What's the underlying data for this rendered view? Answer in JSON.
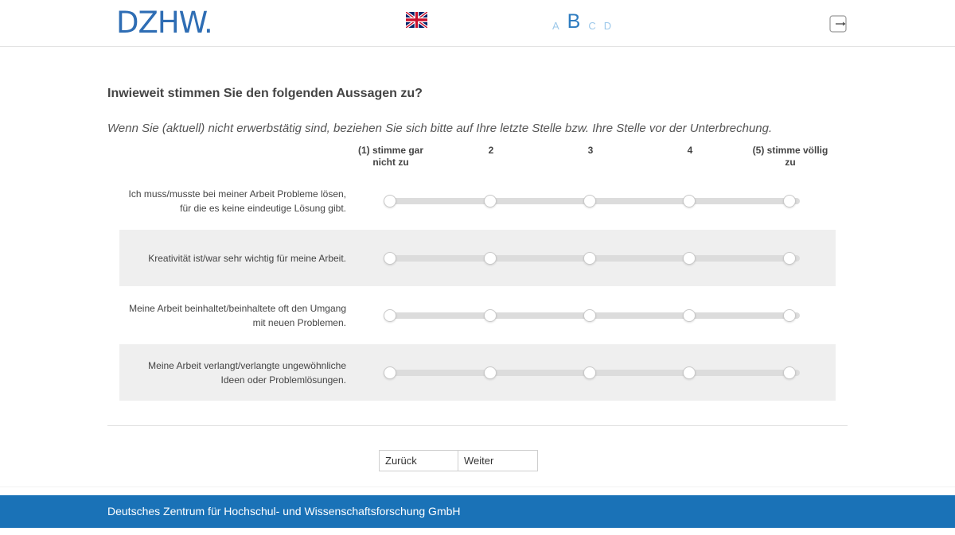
{
  "header": {
    "logo_text": "DZHW.",
    "language_flag": "uk-flag-icon",
    "font_sizes": [
      "A",
      "B",
      "C",
      "D"
    ],
    "font_size_active": "B",
    "logout_icon": "logout-icon"
  },
  "survey": {
    "question": "Inwieweit stimmen Sie den folgenden Aussagen zu?",
    "instruction": "Wenn Sie (aktuell) nicht erwerbstätig sind, beziehen Sie sich bitte auf Ihre letzte Stelle bzw. Ihre Stelle vor der Unterbrechung.",
    "scale_labels": [
      "(1) stimme gar nicht zu",
      "2",
      "3",
      "4",
      "(5) stimme völlig zu"
    ],
    "items": [
      {
        "label": "Ich muss/musste bei meiner Arbeit Probleme lösen, für die es keine eindeutige Lösung gibt."
      },
      {
        "label": "Kreativität ist/war sehr wichtig für meine Arbeit."
      },
      {
        "label": "Meine Arbeit beinhaltet/beinhaltete oft den Umgang mit neuen Problemen."
      },
      {
        "label": "Meine Arbeit verlangt/verlangte ungewöhnliche Ideen oder Problemlösungen."
      }
    ]
  },
  "navigation": {
    "back_label": "Zurück",
    "next_label": "Weiter"
  },
  "footer": {
    "text": "Deutsches Zentrum für Hochschul- und Wissenschaftsforschung GmbH"
  },
  "colors": {
    "brand_blue": "#2e6db4",
    "footer_blue": "#1a72b7",
    "shaded_row": "#efefef",
    "slider_track": "#dcdcdc"
  }
}
